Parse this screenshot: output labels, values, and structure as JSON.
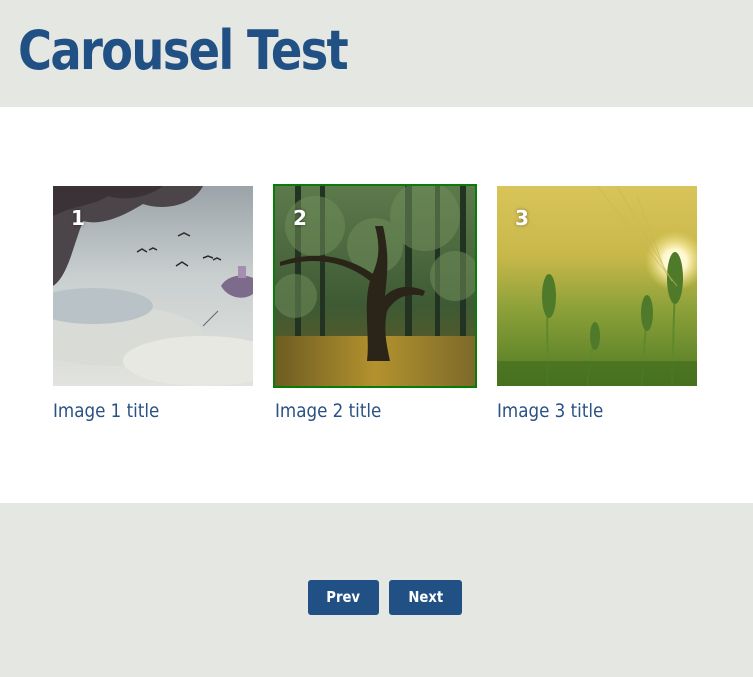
{
  "header": {
    "title": "Carousel Test"
  },
  "carousel": {
    "active_index": 1,
    "slides": [
      {
        "number": "1",
        "title": "Image 1 title",
        "scene": "sky-island-birds"
      },
      {
        "number": "2",
        "title": "Image 2 title",
        "scene": "forest-tree"
      },
      {
        "number": "3",
        "title": "Image 3 title",
        "scene": "wheat-sunset"
      }
    ]
  },
  "controls": {
    "prev_label": "Prev",
    "next_label": "Next"
  },
  "colors": {
    "brand": "#215084",
    "panel": "#e5e7e2",
    "active_border": "#0a7a0a"
  }
}
